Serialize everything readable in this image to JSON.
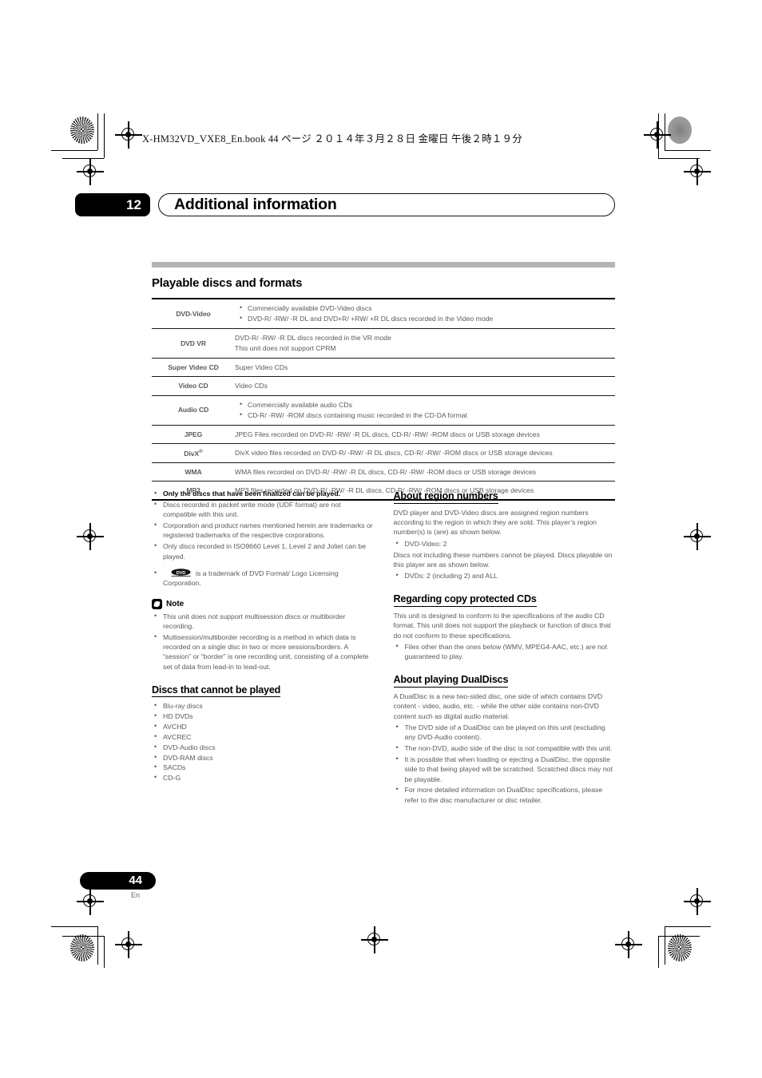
{
  "print_header": {
    "file_line": "X-HM32VD_VXE8_En.book   44 ページ   ２０１４年３月２８日   金曜日   午後２時１９分"
  },
  "chapter": {
    "number": "12",
    "title": "Additional information"
  },
  "section": {
    "title": "Playable discs and formats"
  },
  "table": {
    "rows": [
      {
        "format": "DVD-Video",
        "format_sup": "",
        "bullets": [
          "Commercially available DVD-Video discs",
          "DVD-R/ -RW/ -R DL and DVD+R/ +RW/ +R DL discs recorded in the Video mode"
        ],
        "lines": []
      },
      {
        "format": "DVD VR",
        "format_sup": "",
        "bullets": [],
        "lines": [
          "DVD-R/ -RW/ -R DL discs recorded in the VR mode",
          "This unit does not support CPRM"
        ]
      },
      {
        "format": "Super Video CD",
        "format_sup": "",
        "bullets": [],
        "lines": [
          "Super Video CDs"
        ]
      },
      {
        "format": "Video CD",
        "format_sup": "",
        "bullets": [],
        "lines": [
          "Video CDs"
        ]
      },
      {
        "format": "Audio CD",
        "format_sup": "",
        "bullets": [
          "Commercially available audio CDs",
          "CD-R/ -RW/ -ROM discs containing music recorded in the CD-DA format"
        ],
        "lines": []
      },
      {
        "format": "JPEG",
        "format_sup": "",
        "bullets": [],
        "lines": [
          "JPEG Files recorded on DVD-R/ -RW/ -R DL discs, CD-R/ -RW/ -ROM discs or USB storage devices"
        ]
      },
      {
        "format": "DivX",
        "format_sup": "®",
        "bullets": [],
        "lines": [
          "DivX video files recorded on DVD-R/ -RW/ -R DL discs, CD-R/ -RW/ -ROM discs or USB storage devices"
        ]
      },
      {
        "format": "WMA",
        "format_sup": "",
        "bullets": [],
        "lines": [
          "WMA files recorded on DVD-R/ -RW/ -R DL discs, CD-R/ -RW/ -ROM discs or USB storage devices"
        ]
      },
      {
        "format": "MP3",
        "format_sup": "",
        "bullets": [],
        "lines": [
          "MP3 files recorded on DVD-R/ -RW/ -R DL discs, CD-R/ -RW/ -ROM discs or USB storage devices"
        ]
      }
    ]
  },
  "left_column": {
    "notes_bullets": [
      "Only the discs that have been finalized can be played.",
      "Discs recorded in packet write mode (UDF format) are not compatible with this unit.",
      "Corporation and product names mentioned herein are trademarks or registered trademarks of the respective corporations.",
      "Only discs recorded in ISO9660 Level 1, Level 2 and Joliet can be played."
    ],
    "dvd_trademark_text": "is a trademark of DVD Format/ Logo Licensing Corporation.",
    "note": {
      "label": "Note",
      "bullets": [
        "This unit does not support multisession discs or multiborder recording.",
        "Multisession/multiborder recording is a method in which data is recorded on a single disc in two or more sessions/borders. A “session” or “border” is one recording unit, consisting of a complete set of data from lead-in to lead-out."
      ]
    },
    "cannot_play": {
      "heading": "Discs that cannot be played",
      "items": [
        "Blu-ray discs",
        "HD DVDs",
        "AVCHD",
        "AVCREC",
        "DVD-Audio discs",
        "DVD-RAM discs",
        "SACDs",
        "CD-G"
      ]
    }
  },
  "right_column": {
    "region_numbers": {
      "heading": "About region numbers",
      "para1": "DVD player and DVD-Video discs are assigned region numbers according to the region in which they are sold. This player’s region number(s) is (are) as shown below.",
      "bullets1": [
        "DVD-Video: 2"
      ],
      "para2": "Discs not including these numbers cannot be played. Discs playable on this player are as shown below.",
      "bullets2": [
        "DVDs: 2 (including 2) and ALL"
      ]
    },
    "copy_protected": {
      "heading": "Regarding copy protected CDs",
      "para": "This unit is designed to conform to the specifications of the audio CD format. This unit does not support the playback or function of discs that do not conform to these specifications.",
      "bullets": [
        "Files other than the ones below (WMV, MPEG4-AAC, etc.) are not guaranteed to play."
      ]
    },
    "dualdiscs": {
      "heading": "About playing DualDiscs",
      "para": "A DualDisc is a new two-sided disc, one side of which contains DVD content - video, audio, etc. - while the other side contains non-DVD content such as digital audio material.",
      "bullets": [
        "The DVD side of a DualDisc can be played on this unit (excluding any DVD-Audio content).",
        "The non-DVD, audio side of the disc is not compatible with this unit.",
        "It is possible that when loading or ejecting a DualDisc, the opposite side to that being played will be scratched. Scratched discs may not be playable.",
        "For more detailed information on DualDisc specifications, please refer to the disc manufacturer or disc retailer."
      ]
    }
  },
  "footer": {
    "page_number": "44",
    "language": "En"
  },
  "colors": {
    "rule_gray": "#b4b4b4",
    "body_text": "#5a5a5a",
    "heading_text": "#000000"
  }
}
